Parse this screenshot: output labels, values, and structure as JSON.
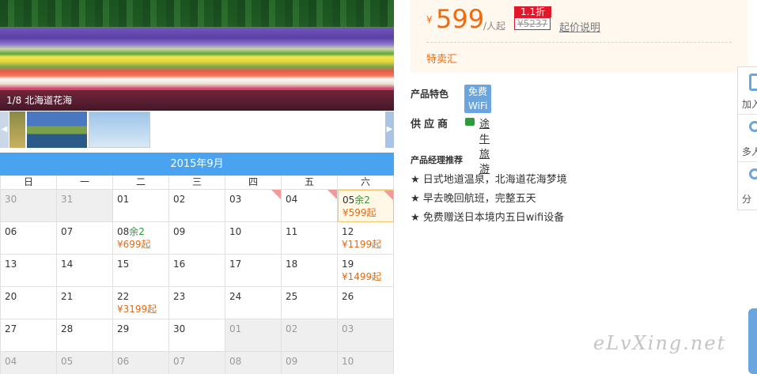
{
  "gallery": {
    "caption": "1/8 北海道花海",
    "prev_icon": "chevron-left-icon",
    "next_icon": "chevron-right-icon"
  },
  "calendar": {
    "title": "2015年9月",
    "weekdays": [
      "日",
      "一",
      "二",
      "三",
      "四",
      "五",
      "六"
    ],
    "cells": [
      {
        "day": "30",
        "other": true,
        "left": "",
        "price": ""
      },
      {
        "day": "31",
        "other": true,
        "left": "",
        "price": ""
      },
      {
        "day": "01",
        "other": false,
        "left": "",
        "price": ""
      },
      {
        "day": "02",
        "other": false,
        "left": "",
        "price": ""
      },
      {
        "day": "03",
        "other": false,
        "left": "",
        "price": "",
        "corner": true
      },
      {
        "day": "04",
        "other": false,
        "left": "",
        "price": "",
        "corner": true
      },
      {
        "day": "05",
        "other": false,
        "left": "余2",
        "price": "¥599起",
        "selected": true,
        "corner": true
      },
      {
        "day": "06",
        "other": false,
        "left": "",
        "price": ""
      },
      {
        "day": "07",
        "other": false,
        "left": "",
        "price": ""
      },
      {
        "day": "08",
        "other": false,
        "left": "余2",
        "price": "¥699起"
      },
      {
        "day": "09",
        "other": false,
        "left": "",
        "price": ""
      },
      {
        "day": "10",
        "other": false,
        "left": "",
        "price": ""
      },
      {
        "day": "11",
        "other": false,
        "left": "",
        "price": ""
      },
      {
        "day": "12",
        "other": false,
        "left": "",
        "price": "¥1199起"
      },
      {
        "day": "13",
        "other": false,
        "left": "",
        "price": ""
      },
      {
        "day": "14",
        "other": false,
        "left": "",
        "price": ""
      },
      {
        "day": "15",
        "other": false,
        "left": "",
        "price": ""
      },
      {
        "day": "16",
        "other": false,
        "left": "",
        "price": ""
      },
      {
        "day": "17",
        "other": false,
        "left": "",
        "price": ""
      },
      {
        "day": "18",
        "other": false,
        "left": "",
        "price": ""
      },
      {
        "day": "19",
        "other": false,
        "left": "",
        "price": "¥1499起"
      },
      {
        "day": "20",
        "other": false,
        "left": "",
        "price": ""
      },
      {
        "day": "21",
        "other": false,
        "left": "",
        "price": ""
      },
      {
        "day": "22",
        "other": false,
        "left": "",
        "price": "¥3199起"
      },
      {
        "day": "23",
        "other": false,
        "left": "",
        "price": ""
      },
      {
        "day": "24",
        "other": false,
        "left": "",
        "price": ""
      },
      {
        "day": "25",
        "other": false,
        "left": "",
        "price": ""
      },
      {
        "day": "26",
        "other": false,
        "left": "",
        "price": ""
      },
      {
        "day": "27",
        "other": false,
        "left": "",
        "price": ""
      },
      {
        "day": "28",
        "other": false,
        "left": "",
        "price": ""
      },
      {
        "day": "29",
        "other": false,
        "left": "",
        "price": ""
      },
      {
        "day": "30",
        "other": false,
        "left": "",
        "price": ""
      },
      {
        "day": "01",
        "other": true,
        "left": "",
        "price": ""
      },
      {
        "day": "02",
        "other": true,
        "left": "",
        "price": ""
      },
      {
        "day": "03",
        "other": true,
        "left": "",
        "price": ""
      },
      {
        "day": "04",
        "other": true,
        "left": "",
        "price": ""
      },
      {
        "day": "05",
        "other": true,
        "left": "",
        "price": ""
      },
      {
        "day": "06",
        "other": true,
        "left": "",
        "price": ""
      },
      {
        "day": "07",
        "other": true,
        "left": "",
        "price": ""
      },
      {
        "day": "08",
        "other": true,
        "left": "",
        "price": ""
      },
      {
        "day": "09",
        "other": true,
        "left": "",
        "price": ""
      },
      {
        "day": "10",
        "other": true,
        "left": "",
        "price": ""
      }
    ]
  },
  "price": {
    "currency": "¥",
    "amount": "599",
    "unit": "/人起",
    "discount": "1.1折",
    "original": "¥5237",
    "explain_link": "起价说明",
    "special": "特卖汇"
  },
  "features": {
    "label": "产品特色",
    "badge": "免费WiFi"
  },
  "supplier": {
    "label": "供应商",
    "name": "途牛旅游",
    "icon": "store-icon"
  },
  "recommend": {
    "title": "产品经理推荐",
    "items": [
      "★ 日式地道温泉，北海道花海梦境",
      "★ 早去晚回航班，完整五天",
      "★ 免费赠送日本境内五日wifi设备"
    ]
  },
  "tools": [
    {
      "label": "加入",
      "icon": "bookmark-icon"
    },
    {
      "label": "多人",
      "icon": "user-icon"
    },
    {
      "label": "分",
      "icon": "share-icon"
    }
  ],
  "watermark": "eLvXing.net",
  "colors": {
    "accent_orange": "#f06a0f",
    "calendar_blue": "#4aa3f0",
    "discount_red": "#e0182c",
    "remaining_green": "#2e9a3a"
  }
}
